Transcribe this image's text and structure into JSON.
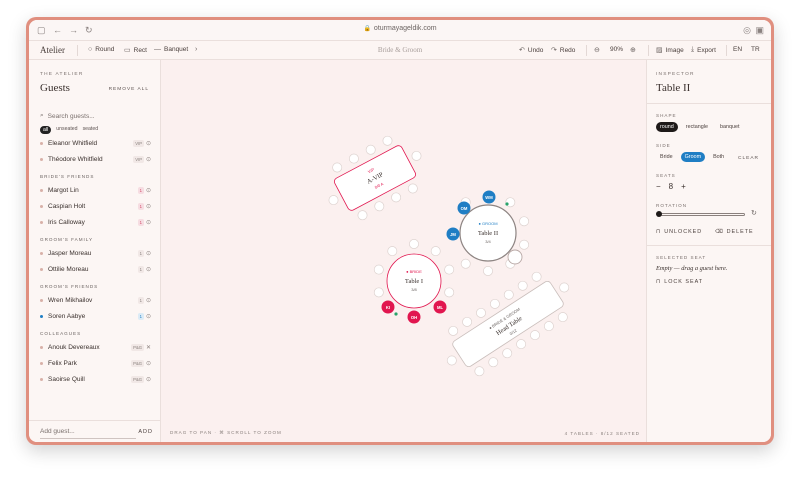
{
  "browser": {
    "url": "oturmayageldik.com",
    "icons": [
      "sidebar-icon",
      "back-icon",
      "forward-icon",
      "reload-icon",
      "extension-icon",
      "window-icon"
    ]
  },
  "toolbar": {
    "app_name": "Atelier",
    "tools": [
      {
        "label": "Round",
        "icon": "circle-icon"
      },
      {
        "label": "Rect",
        "icon": "rect-icon"
      },
      {
        "label": "Banquet",
        "icon": "banquet-icon"
      }
    ],
    "title": "Bride & Groom",
    "undo": "Undo",
    "redo": "Redo",
    "zoom": "90%",
    "image": "Image",
    "export": "Export",
    "lang_en": "EN",
    "lang_tr": "TR"
  },
  "guests_panel": {
    "atelier": "THE ATELIER",
    "title": "Guests",
    "remove_all": "REMOVE ALL",
    "search_placeholder": "Search guests...",
    "filters": [
      "all",
      "unseated",
      "seated"
    ],
    "top_rows": [
      {
        "name": "Eleanor Whitfield",
        "tag": "VIP"
      },
      {
        "name": "Théodore Whitfield",
        "tag": "VIP"
      }
    ],
    "groups": [
      {
        "title": "BRIDE'S FRIENDS",
        "rows": [
          {
            "name": "Margot Lin",
            "tag": "1"
          },
          {
            "name": "Caspian Holt",
            "tag": "1"
          },
          {
            "name": "Iris Calloway",
            "tag": "1"
          }
        ]
      },
      {
        "title": "GROOM'S FAMILY",
        "rows": [
          {
            "name": "Jasper Moreau",
            "tag": "1"
          },
          {
            "name": "Ottilie Moreau",
            "tag": "1"
          }
        ]
      },
      {
        "title": "GROOM'S FRIENDS",
        "rows": [
          {
            "name": "Wren Mikhailov",
            "tag": "1"
          },
          {
            "name": "Soren Aabye",
            "tag": "1"
          }
        ]
      },
      {
        "title": "COLLEAGUES",
        "rows": [
          {
            "name": "Anouk Devereaux",
            "tag": "P&G"
          },
          {
            "name": "Felix Park",
            "tag": "P&G"
          },
          {
            "name": "Saoirse Quill",
            "tag": "P&G"
          }
        ]
      }
    ],
    "add_placeholder": "Add guest...",
    "add_label": "ADD"
  },
  "canvas": {
    "hint": "DRAG TO PAN · ⌘ SCROLL TO ZOOM",
    "count": "4 TABLES · 8/12 SEATED",
    "tables": {
      "vip": {
        "tag": "VIP",
        "name": "A-VIP",
        "count": "0/0 A"
      },
      "t1": {
        "tag": "● BRIDE",
        "name": "Table I",
        "count": "3/8",
        "guests": [
          "KI",
          "OH",
          "ML"
        ]
      },
      "t2": {
        "tag": "● GROOM",
        "name": "Table II",
        "count": "3/4",
        "guests": [
          "OM",
          "WM",
          "JM"
        ]
      },
      "head": {
        "tag": "● BRIDE & GROOM",
        "name": "Head Table",
        "count": "0/12"
      }
    },
    "colors": {
      "bride": "#e1164f",
      "groom": "#1f7ec4"
    }
  },
  "inspector": {
    "label": "INSPECTOR",
    "title": "Table II",
    "shape_label": "SHAPE",
    "shapes": [
      "round",
      "rectangle",
      "banquet"
    ],
    "side_label": "SIDE",
    "sides": [
      "Bride",
      "Groom",
      "Both"
    ],
    "clear": "CLEAR",
    "seats_label": "SEATS",
    "seats_minus": "−",
    "seats_value": "8",
    "seats_plus": "+",
    "rotation_label": "ROTATION",
    "rotation_value": 0,
    "unlocked": "UNLOCKED",
    "delete": "DELETE",
    "selected_seat_label": "SELECTED SEAT",
    "empty_text": "Empty — drag a guest here.",
    "lock_seat": "LOCK SEAT"
  }
}
